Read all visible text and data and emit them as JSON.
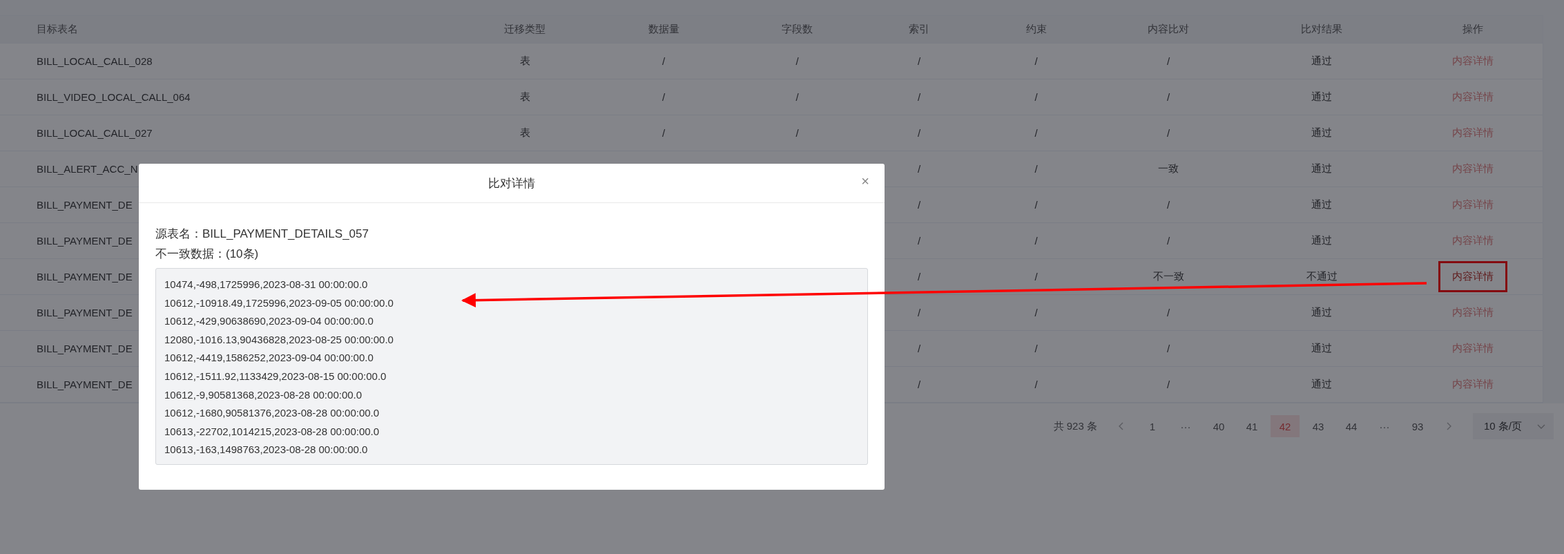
{
  "table": {
    "columns": [
      "目标表名",
      "迁移类型",
      "数据量",
      "字段数",
      "索引",
      "约束",
      "内容比对",
      "比对结果",
      "操作"
    ],
    "rows": [
      {
        "name": "BILL_LOCAL_CALL_028",
        "type": "表",
        "data_volume": "/",
        "field_count": "/",
        "index": "/",
        "constraint": "/",
        "content_compare": "/",
        "result": "通过",
        "action": "内容详情",
        "highlighted": false
      },
      {
        "name": "BILL_VIDEO_LOCAL_CALL_064",
        "type": "表",
        "data_volume": "/",
        "field_count": "/",
        "index": "/",
        "constraint": "/",
        "content_compare": "/",
        "result": "通过",
        "action": "内容详情",
        "highlighted": false
      },
      {
        "name": "BILL_LOCAL_CALL_027",
        "type": "表",
        "data_volume": "/",
        "field_count": "/",
        "index": "/",
        "constraint": "/",
        "content_compare": "/",
        "result": "通过",
        "action": "内容详情",
        "highlighted": false
      },
      {
        "name": "BILL_ALERT_ACC_N",
        "index": "/",
        "constraint": "/",
        "content_compare": "一致",
        "result": "通过",
        "action": "内容详情",
        "highlighted": false
      },
      {
        "name": "BILL_PAYMENT_DE",
        "index": "/",
        "constraint": "/",
        "content_compare": "/",
        "result": "通过",
        "action": "内容详情",
        "highlighted": false
      },
      {
        "name": "BILL_PAYMENT_DE",
        "index": "/",
        "constraint": "/",
        "content_compare": "/",
        "result": "通过",
        "action": "内容详情",
        "highlighted": false
      },
      {
        "name": "BILL_PAYMENT_DE",
        "index": "/",
        "constraint": "/",
        "content_compare": "不一致",
        "result": "不通过",
        "action": "内容详情",
        "highlighted": true
      },
      {
        "name": "BILL_PAYMENT_DE",
        "index": "/",
        "constraint": "/",
        "content_compare": "/",
        "result": "通过",
        "action": "内容详情",
        "highlighted": false
      },
      {
        "name": "BILL_PAYMENT_DE",
        "index": "/",
        "constraint": "/",
        "content_compare": "/",
        "result": "通过",
        "action": "内容详情",
        "highlighted": false
      },
      {
        "name": "BILL_PAYMENT_DE",
        "index": "/",
        "constraint": "/",
        "content_compare": "/",
        "result": "通过",
        "action": "内容详情",
        "highlighted": false
      }
    ]
  },
  "pagination": {
    "total": "共 923 条",
    "pages": [
      {
        "label": "1",
        "selected": false
      },
      {
        "label": "···",
        "selected": false
      },
      {
        "label": "40",
        "selected": false
      },
      {
        "label": "41",
        "selected": false
      },
      {
        "label": "42",
        "selected": true
      },
      {
        "label": "43",
        "selected": false
      },
      {
        "label": "44",
        "selected": false
      },
      {
        "label": "···",
        "selected": false
      },
      {
        "label": "93",
        "selected": false
      }
    ],
    "page_size": "10 条/页"
  },
  "dialog": {
    "title": "比对详情",
    "close": "×",
    "source_table": "源表名：BILL_PAYMENT_DETAILS_057",
    "mismatch_label": "不一致数据：(10条)",
    "records": [
      "10474,-498,1725996,2023-08-31 00:00:00.0",
      "10612,-10918.49,1725996,2023-09-05 00:00:00.0",
      "10612,-429,90638690,2023-09-04 00:00:00.0",
      "12080,-1016.13,90436828,2023-08-25 00:00:00.0",
      "10612,-4419,1586252,2023-09-04 00:00:00.0",
      "10612,-1511.92,1133429,2023-08-15 00:00:00.0",
      "10612,-9,90581368,2023-08-28 00:00:00.0",
      "10612,-1680,90581376,2023-08-28 00:00:00.0",
      "10613,-22702,1014215,2023-08-28 00:00:00.0",
      "10613,-163,1498763,2023-08-28 00:00:00.0"
    ]
  }
}
